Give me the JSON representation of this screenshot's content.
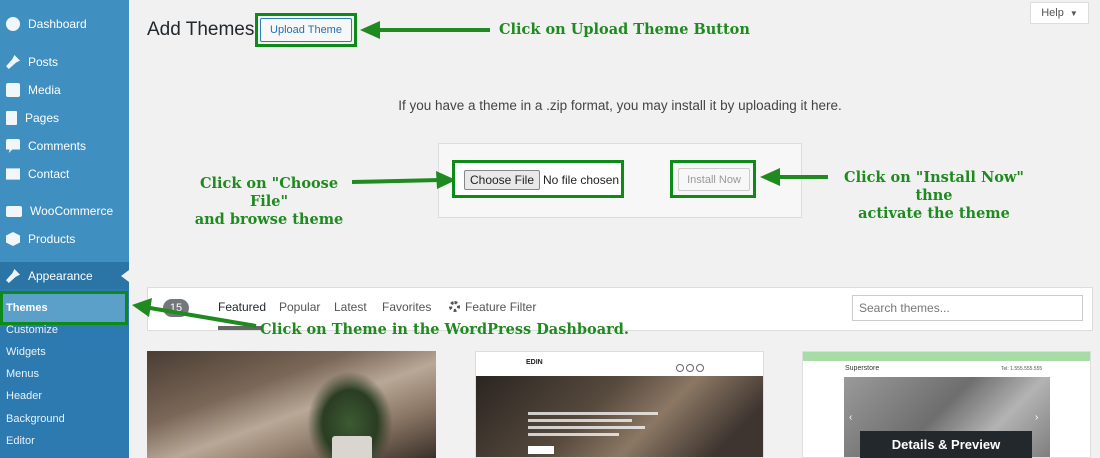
{
  "sidebar": {
    "items": [
      {
        "label": "Dashboard",
        "icon": "dashboard-icon"
      },
      {
        "label": "Posts",
        "icon": "pushpin-icon"
      },
      {
        "label": "Media",
        "icon": "media-icon"
      },
      {
        "label": "Pages",
        "icon": "pages-icon"
      },
      {
        "label": "Comments",
        "icon": "comment-icon"
      },
      {
        "label": "Contact",
        "icon": "envelope-icon"
      },
      {
        "label": "WooCommerce",
        "icon": "woocommerce-icon"
      },
      {
        "label": "Products",
        "icon": "box-icon"
      },
      {
        "label": "Appearance",
        "icon": "paintbrush-icon"
      }
    ],
    "submenu": [
      "Themes",
      "Customize",
      "Widgets",
      "Menus",
      "Header",
      "Background",
      "Editor"
    ],
    "color": "#3f8fc0",
    "active_color": "#2b74a6"
  },
  "header": {
    "title": "Add Themes",
    "upload_button": "Upload Theme",
    "help_label": "Help"
  },
  "upload": {
    "help_text": "If you have a theme in a .zip format, you may install it by uploading it here.",
    "choose_file_label": "Choose File",
    "no_file_text": "No file chosen",
    "install_button": "Install Now"
  },
  "filter": {
    "count": "15",
    "tabs": [
      "Featured",
      "Popular",
      "Latest",
      "Favorites"
    ],
    "feature_filter": "Feature Filter",
    "search_placeholder": "Search themes..."
  },
  "themes": {
    "card2_logo": "EDIN",
    "card3_logo": "Superstore",
    "card3_phone": "Tel: 1.555.555.555",
    "details_button": "Details & Preview"
  },
  "annotations": {
    "upload": "Click on Upload Theme Button",
    "choose_file_line1": "Click on \"Choose File\"",
    "choose_file_line2": "and browse theme",
    "install_line1": "Click on \"Install Now\" thne",
    "install_line2": "activate the theme",
    "themes": "Click on Theme in the WordPress Dashboard."
  },
  "colors": {
    "annotation_green": "#1f8a1f",
    "highlight_border": "#0d8a17"
  }
}
